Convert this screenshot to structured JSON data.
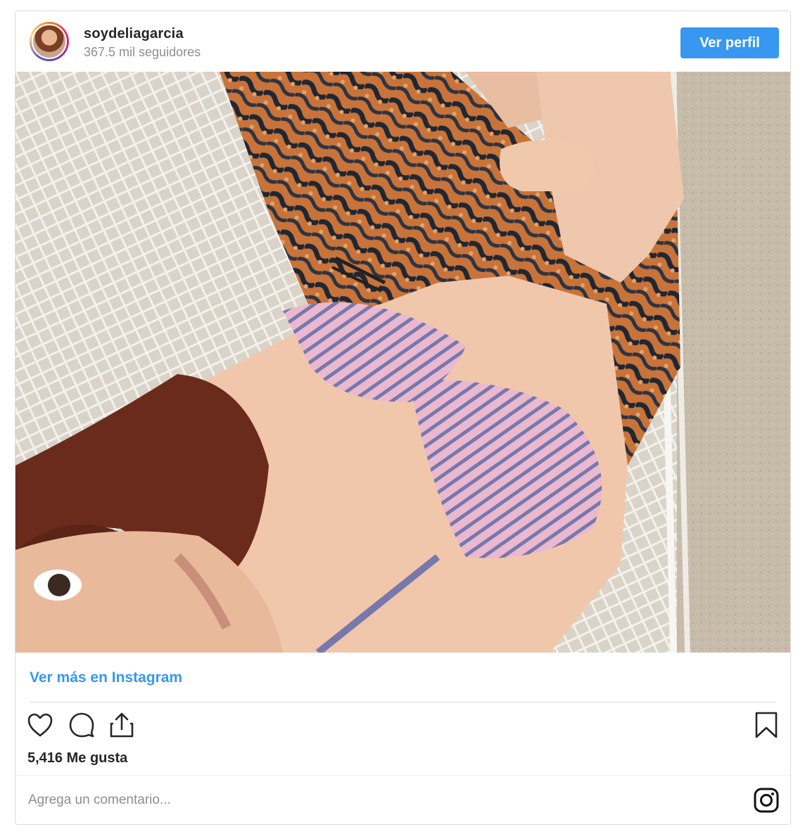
{
  "post": {
    "username": "soydeliagarcia",
    "followers": "367.5 mil seguidores",
    "profile_button": "Ver perfil",
    "more_link": "Ver más en Instagram",
    "likes": "5,416 Me gusta",
    "comment_placeholder": "Agrega un comentario..."
  },
  "icons": {
    "like": "heart-icon",
    "comment": "comment-icon",
    "share": "share-icon",
    "save": "bookmark-icon",
    "brand": "instagram-icon"
  },
  "colors": {
    "accent": "#3897f0",
    "text": "#262626",
    "muted": "#8e8e8e",
    "border": "#dbdbdb"
  }
}
